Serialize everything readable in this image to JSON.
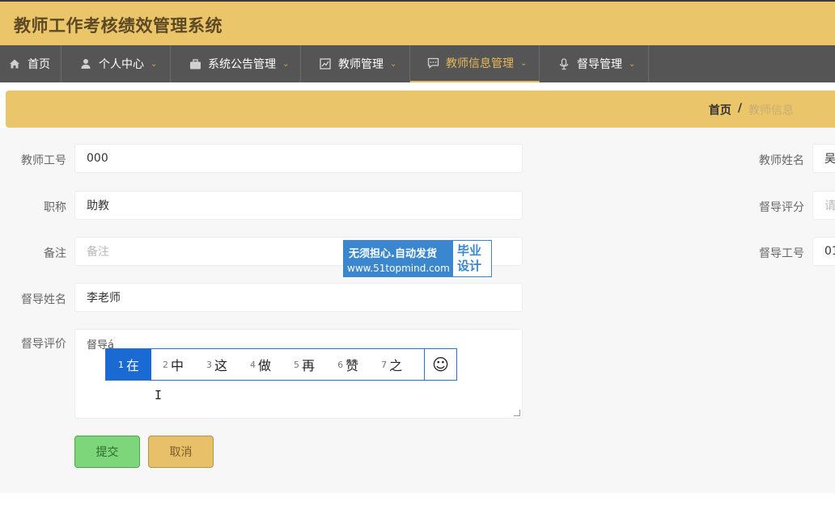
{
  "app": {
    "title": "教师工作考核绩效管理系统"
  },
  "nav": {
    "items": [
      {
        "label": "首页",
        "icon": "home-icon",
        "has_dropdown": false,
        "active": false
      },
      {
        "label": "个人中心",
        "icon": "user-icon",
        "has_dropdown": true,
        "active": false
      },
      {
        "label": "系统公告管理",
        "icon": "briefcase-icon",
        "has_dropdown": true,
        "active": false
      },
      {
        "label": "教师管理",
        "icon": "chart-icon",
        "has_dropdown": true,
        "active": false
      },
      {
        "label": "教师信息管理",
        "icon": "message-icon",
        "has_dropdown": true,
        "active": true
      },
      {
        "label": "督导管理",
        "icon": "microphone-icon",
        "has_dropdown": true,
        "active": false
      }
    ]
  },
  "breadcrumb": {
    "home": "首页",
    "separator": "/",
    "current": "教师信息"
  },
  "form": {
    "teacher_id": {
      "label": "教师工号",
      "value": "000"
    },
    "title": {
      "label": "职称",
      "value": "助教"
    },
    "remark": {
      "label": "备注",
      "placeholder": "备注"
    },
    "supervisor_name": {
      "label": "督导姓名",
      "value": "李老师"
    },
    "supervisor_comment": {
      "label": "督导评价",
      "value": "督导á"
    },
    "teacher_name": {
      "label": "教师姓名",
      "value": "吴"
    },
    "supervisor_score": {
      "label": "督导评分",
      "placeholder": "请"
    },
    "supervisor_id": {
      "label": "督导工号",
      "value": "01"
    }
  },
  "buttons": {
    "submit": "提交",
    "cancel": "取消"
  },
  "watermark": {
    "line1": "无须担心.自动发货",
    "line2": "www.51topmind.com",
    "right_line1": "毕业",
    "right_line2": "设计"
  },
  "ime": {
    "candidates": [
      {
        "num": "1",
        "text": "在"
      },
      {
        "num": "2",
        "text": "中"
      },
      {
        "num": "3",
        "text": "这"
      },
      {
        "num": "4",
        "text": "做"
      },
      {
        "num": "5",
        "text": "再"
      },
      {
        "num": "6",
        "text": "赞"
      },
      {
        "num": "7",
        "text": "之"
      }
    ],
    "emoji": "☺"
  },
  "colors": {
    "accent": "#ebc56a",
    "nav_bg": "#555555",
    "submit": "#7ed67a",
    "cancel": "#e8c069",
    "ime_selected": "#1a6ad4"
  }
}
